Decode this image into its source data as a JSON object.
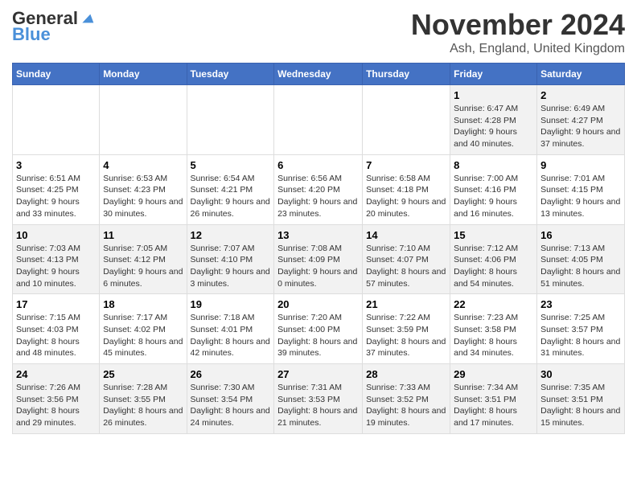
{
  "header": {
    "logo_general": "General",
    "logo_blue": "Blue",
    "month_title": "November 2024",
    "location": "Ash, England, United Kingdom"
  },
  "days_of_week": [
    "Sunday",
    "Monday",
    "Tuesday",
    "Wednesday",
    "Thursday",
    "Friday",
    "Saturday"
  ],
  "weeks": [
    [
      {
        "day": "",
        "info": ""
      },
      {
        "day": "",
        "info": ""
      },
      {
        "day": "",
        "info": ""
      },
      {
        "day": "",
        "info": ""
      },
      {
        "day": "",
        "info": ""
      },
      {
        "day": "1",
        "info": "Sunrise: 6:47 AM\nSunset: 4:28 PM\nDaylight: 9 hours and 40 minutes."
      },
      {
        "day": "2",
        "info": "Sunrise: 6:49 AM\nSunset: 4:27 PM\nDaylight: 9 hours and 37 minutes."
      }
    ],
    [
      {
        "day": "3",
        "info": "Sunrise: 6:51 AM\nSunset: 4:25 PM\nDaylight: 9 hours and 33 minutes."
      },
      {
        "day": "4",
        "info": "Sunrise: 6:53 AM\nSunset: 4:23 PM\nDaylight: 9 hours and 30 minutes."
      },
      {
        "day": "5",
        "info": "Sunrise: 6:54 AM\nSunset: 4:21 PM\nDaylight: 9 hours and 26 minutes."
      },
      {
        "day": "6",
        "info": "Sunrise: 6:56 AM\nSunset: 4:20 PM\nDaylight: 9 hours and 23 minutes."
      },
      {
        "day": "7",
        "info": "Sunrise: 6:58 AM\nSunset: 4:18 PM\nDaylight: 9 hours and 20 minutes."
      },
      {
        "day": "8",
        "info": "Sunrise: 7:00 AM\nSunset: 4:16 PM\nDaylight: 9 hours and 16 minutes."
      },
      {
        "day": "9",
        "info": "Sunrise: 7:01 AM\nSunset: 4:15 PM\nDaylight: 9 hours and 13 minutes."
      }
    ],
    [
      {
        "day": "10",
        "info": "Sunrise: 7:03 AM\nSunset: 4:13 PM\nDaylight: 9 hours and 10 minutes."
      },
      {
        "day": "11",
        "info": "Sunrise: 7:05 AM\nSunset: 4:12 PM\nDaylight: 9 hours and 6 minutes."
      },
      {
        "day": "12",
        "info": "Sunrise: 7:07 AM\nSunset: 4:10 PM\nDaylight: 9 hours and 3 minutes."
      },
      {
        "day": "13",
        "info": "Sunrise: 7:08 AM\nSunset: 4:09 PM\nDaylight: 9 hours and 0 minutes."
      },
      {
        "day": "14",
        "info": "Sunrise: 7:10 AM\nSunset: 4:07 PM\nDaylight: 8 hours and 57 minutes."
      },
      {
        "day": "15",
        "info": "Sunrise: 7:12 AM\nSunset: 4:06 PM\nDaylight: 8 hours and 54 minutes."
      },
      {
        "day": "16",
        "info": "Sunrise: 7:13 AM\nSunset: 4:05 PM\nDaylight: 8 hours and 51 minutes."
      }
    ],
    [
      {
        "day": "17",
        "info": "Sunrise: 7:15 AM\nSunset: 4:03 PM\nDaylight: 8 hours and 48 minutes."
      },
      {
        "day": "18",
        "info": "Sunrise: 7:17 AM\nSunset: 4:02 PM\nDaylight: 8 hours and 45 minutes."
      },
      {
        "day": "19",
        "info": "Sunrise: 7:18 AM\nSunset: 4:01 PM\nDaylight: 8 hours and 42 minutes."
      },
      {
        "day": "20",
        "info": "Sunrise: 7:20 AM\nSunset: 4:00 PM\nDaylight: 8 hours and 39 minutes."
      },
      {
        "day": "21",
        "info": "Sunrise: 7:22 AM\nSunset: 3:59 PM\nDaylight: 8 hours and 37 minutes."
      },
      {
        "day": "22",
        "info": "Sunrise: 7:23 AM\nSunset: 3:58 PM\nDaylight: 8 hours and 34 minutes."
      },
      {
        "day": "23",
        "info": "Sunrise: 7:25 AM\nSunset: 3:57 PM\nDaylight: 8 hours and 31 minutes."
      }
    ],
    [
      {
        "day": "24",
        "info": "Sunrise: 7:26 AM\nSunset: 3:56 PM\nDaylight: 8 hours and 29 minutes."
      },
      {
        "day": "25",
        "info": "Sunrise: 7:28 AM\nSunset: 3:55 PM\nDaylight: 8 hours and 26 minutes."
      },
      {
        "day": "26",
        "info": "Sunrise: 7:30 AM\nSunset: 3:54 PM\nDaylight: 8 hours and 24 minutes."
      },
      {
        "day": "27",
        "info": "Sunrise: 7:31 AM\nSunset: 3:53 PM\nDaylight: 8 hours and 21 minutes."
      },
      {
        "day": "28",
        "info": "Sunrise: 7:33 AM\nSunset: 3:52 PM\nDaylight: 8 hours and 19 minutes."
      },
      {
        "day": "29",
        "info": "Sunrise: 7:34 AM\nSunset: 3:51 PM\nDaylight: 8 hours and 17 minutes."
      },
      {
        "day": "30",
        "info": "Sunrise: 7:35 AM\nSunset: 3:51 PM\nDaylight: 8 hours and 15 minutes."
      }
    ]
  ]
}
